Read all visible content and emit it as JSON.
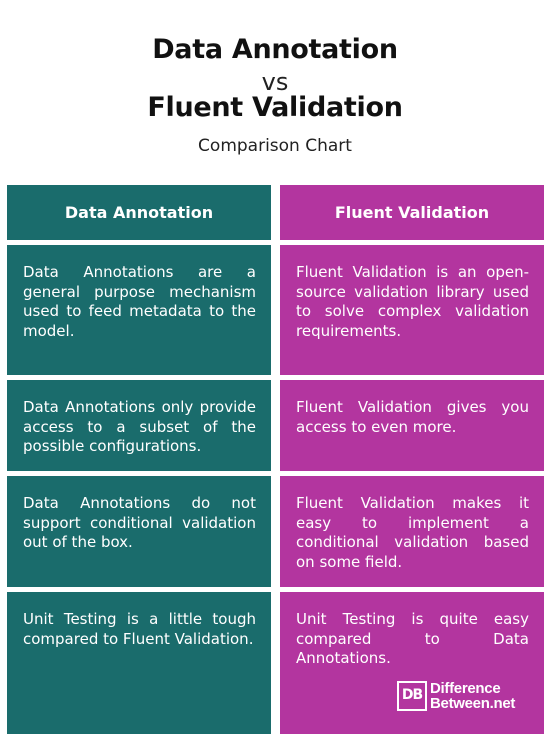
{
  "header": {
    "title_line1": "Data Annotation",
    "vs": "vs",
    "title_line2": "Fluent Validation",
    "subtitle": "Comparison Chart"
  },
  "columns": {
    "left": "Data Annotation",
    "right": "Fluent Validation"
  },
  "rows": [
    {
      "left": "Data Annotations are a general purpose mechanism used to feed metadata to the model.",
      "right": "Fluent Validation is an open-source validation library used to solve complex validation requirements."
    },
    {
      "left": "Data Annotations only provide access to a subset of the possible configurations.",
      "right": "Fluent Validation gives you access to even more."
    },
    {
      "left": "Data Annotations do not support conditional validation out of the box.",
      "right": "Fluent Validation makes it easy to implement a conditional validation based on some field."
    },
    {
      "left": "Unit Testing is a little tough compared to Fluent Validation.",
      "right": "Unit Testing is quite easy compared to Data Annotations."
    }
  ],
  "logo": {
    "mark": "DB",
    "line1": "Difference",
    "line2": "Between.net"
  },
  "colors": {
    "left_column": "#1a6c6c",
    "right_column": "#b3359f",
    "text_on_columns": "#ffffff"
  }
}
